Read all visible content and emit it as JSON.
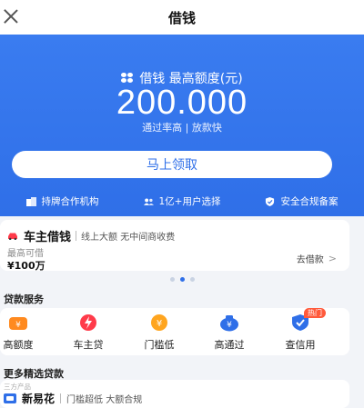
{
  "titlebar": {
    "title": "借钱",
    "close_icon": "close-icon"
  },
  "hero": {
    "label": "借钱 最高额度(元)",
    "amount": "200.000",
    "subtitle": "通过率高 | 放款快",
    "cta_label": "马上领取",
    "features": [
      {
        "icon": "building-icon",
        "label": "持牌合作机构"
      },
      {
        "icon": "users-icon",
        "label": "1亿+用户选择"
      },
      {
        "icon": "shield-check-icon",
        "label": "安全合规备案"
      }
    ]
  },
  "car_loan": {
    "name": "车主借钱",
    "description": "线上大额 无中间商收费",
    "max_label": "最高可借",
    "max_value": "¥100万",
    "action_label": "去借款",
    "arrow": ">"
  },
  "carousel": {
    "pages": 3,
    "active": 2
  },
  "services": {
    "title": "贷款服务",
    "items": [
      {
        "icon": "money-bag-icon",
        "label": "高额度",
        "color": "#ff8a1f"
      },
      {
        "icon": "lightning-icon",
        "label": "车主贷",
        "color": "#ff3b4a"
      },
      {
        "icon": "coin-icon",
        "label": "门槛低",
        "color": "#ffa51f"
      },
      {
        "icon": "money-pot-icon",
        "label": "高通过",
        "color": "#2f6fe8"
      },
      {
        "icon": "credit-check-icon",
        "label": "查信用",
        "color": "#2f6fe8",
        "badge": "热门"
      }
    ]
  },
  "more": {
    "title": "更多精选贷款",
    "tag": "三方产品",
    "product_name": "新易花",
    "product_desc": "门槛超低 大额合规"
  },
  "colors": {
    "primary": "#2f6fe8",
    "accent_orange": "#ff8a1f",
    "accent_red": "#ff3b4a"
  }
}
